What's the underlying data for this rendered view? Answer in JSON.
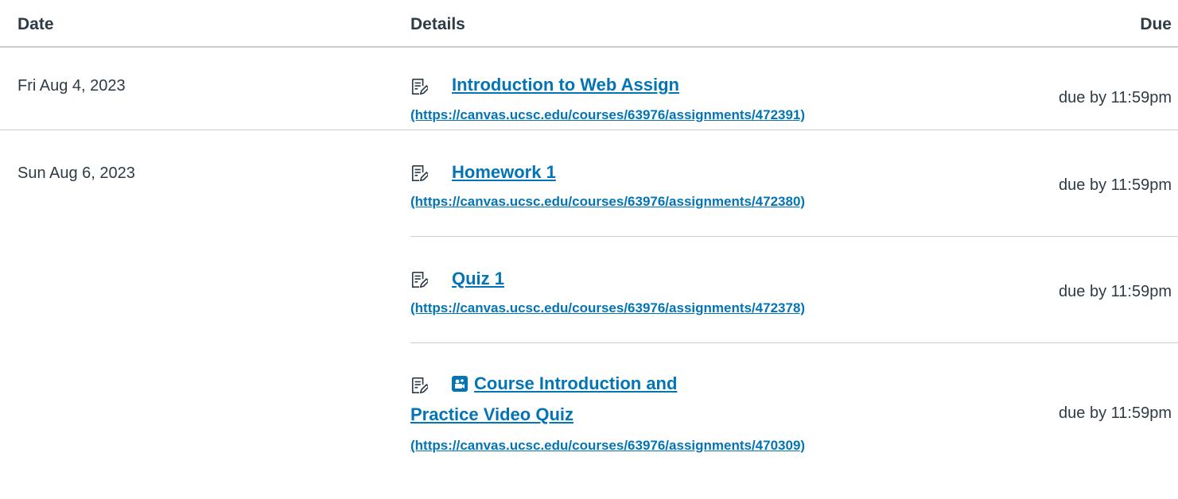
{
  "header": {
    "date": "Date",
    "details": "Details",
    "due": "Due"
  },
  "groups": [
    {
      "date": "Fri Aug 4, 2023",
      "items": [
        {
          "icon": "assignment-icon",
          "title": "Introduction to Web Assign",
          "url": "(https://canvas.ucsc.edu/courses/63976/assignments/472391)",
          "due": "due by 11:59pm"
        }
      ]
    },
    {
      "date": "Sun Aug 6, 2023",
      "items": [
        {
          "icon": "assignment-icon",
          "title": "Homework 1",
          "url": "(https://canvas.ucsc.edu/courses/63976/assignments/472380)",
          "due": "due by 11:59pm"
        },
        {
          "icon": "assignment-icon",
          "title": "Quiz 1",
          "url": "(https://canvas.ucsc.edu/courses/63976/assignments/472378)",
          "due": "due by 11:59pm"
        },
        {
          "icon": "assignment-icon",
          "media_icon": "video-icon",
          "title_line1": "Course Introduction and",
          "title_line2": "Practice Video Quiz",
          "url": "(https://canvas.ucsc.edu/courses/63976/assignments/470309)",
          "due": "due by 11:59pm"
        }
      ]
    }
  ],
  "colors": {
    "link": "#0374b5",
    "text": "#2d3b45",
    "divider": "#c7cdd1"
  }
}
